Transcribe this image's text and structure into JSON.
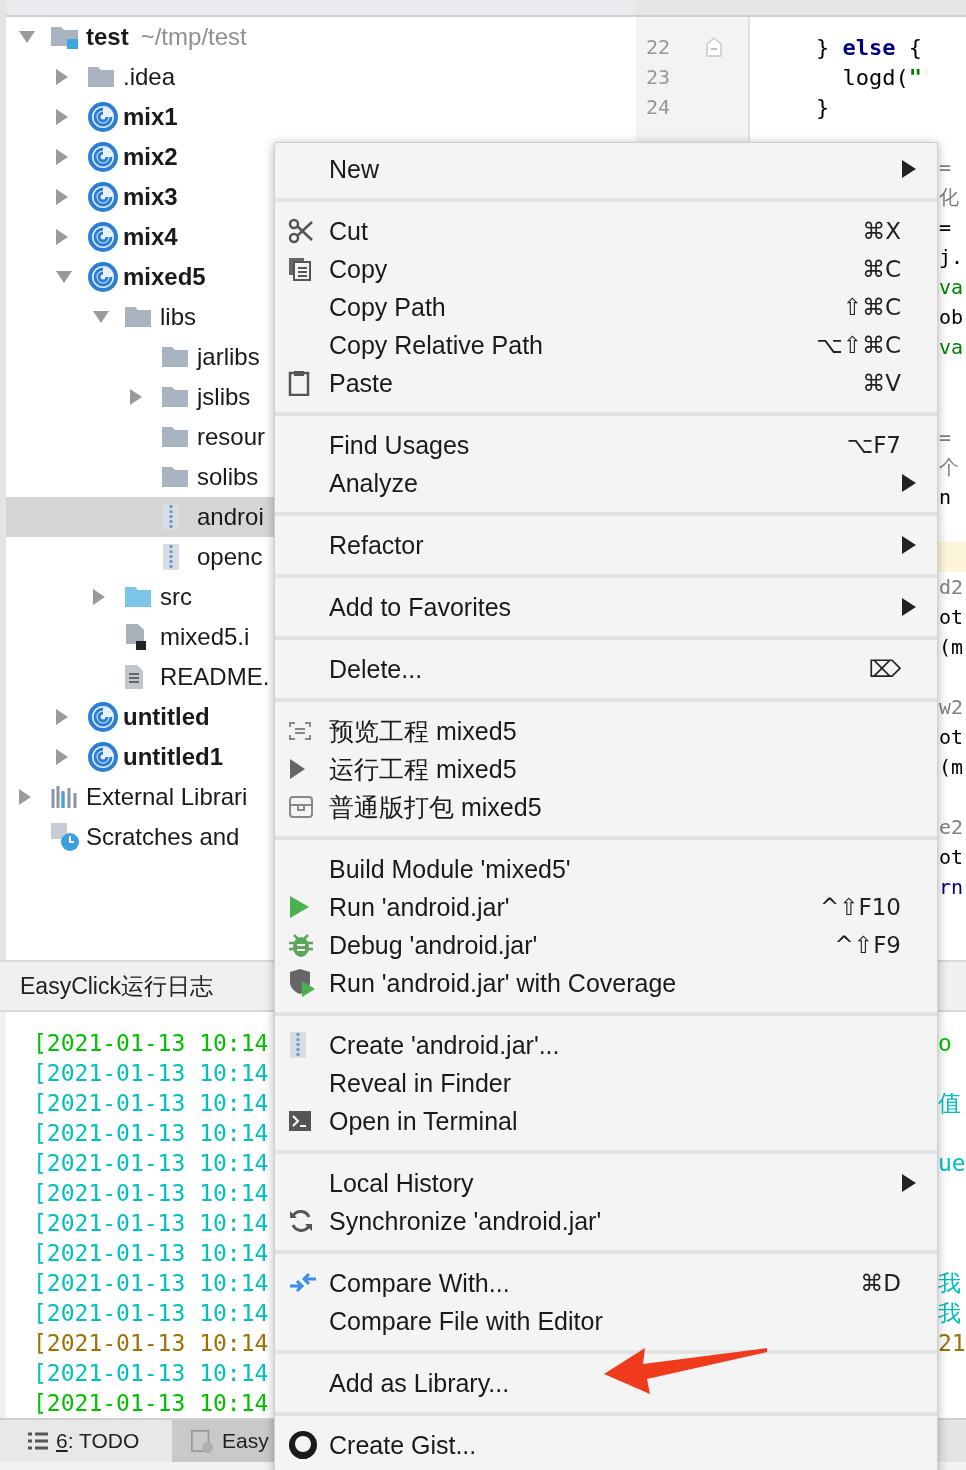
{
  "project_panel": {
    "tree": [
      {
        "label": "test",
        "hint": "~/tmp/test",
        "kind": "project",
        "expanded": true,
        "selected": false,
        "children": [
          {
            "label": ".idea",
            "kind": "folder",
            "expanded": false,
            "selected": false
          },
          {
            "label": "mix1",
            "kind": "module",
            "expanded": false,
            "selected": false
          },
          {
            "label": "mix2",
            "kind": "module",
            "expanded": false,
            "selected": false
          },
          {
            "label": "mix3",
            "kind": "module",
            "expanded": false,
            "selected": false
          },
          {
            "label": "mix4",
            "kind": "module",
            "expanded": false,
            "selected": false
          },
          {
            "label": "mixed5",
            "kind": "module",
            "expanded": true,
            "selected": false,
            "children": [
              {
                "label": "libs",
                "kind": "folder",
                "expanded": true,
                "selected": false,
                "children": [
                  {
                    "label": "jarlibs",
                    "kind": "folder",
                    "selected": false
                  },
                  {
                    "label": "jslibs",
                    "kind": "folder",
                    "expanded": false,
                    "selected": false
                  },
                  {
                    "label": "resour",
                    "kind": "folder",
                    "selected": false
                  },
                  {
                    "label": "solibs",
                    "kind": "folder",
                    "selected": false
                  },
                  {
                    "label": "androi",
                    "kind": "jar",
                    "selected": true
                  },
                  {
                    "label": "openc",
                    "kind": "jar",
                    "selected": false
                  }
                ]
              },
              {
                "label": "src",
                "kind": "source",
                "expanded": false,
                "selected": false
              },
              {
                "label": "mixed5.i",
                "kind": "module-file",
                "selected": false
              },
              {
                "label": "README.",
                "kind": "text-file",
                "selected": false
              }
            ]
          },
          {
            "label": "untitled",
            "kind": "module",
            "expanded": false,
            "selected": false
          },
          {
            "label": "untitled1",
            "kind": "module",
            "expanded": false,
            "selected": false
          }
        ]
      },
      {
        "label": "External Librari",
        "kind": "libraries",
        "expanded": false,
        "selected": false
      },
      {
        "label": "Scratches and",
        "kind": "scratches",
        "selected": false
      }
    ]
  },
  "editor": {
    "lines": [
      {
        "number": "22",
        "fold_marker": true,
        "code": [
          {
            "text": "} ",
            "kind": "plain"
          },
          {
            "text": "else",
            "kind": "keyword"
          },
          {
            "text": " {",
            "kind": "plain"
          }
        ]
      },
      {
        "number": "23",
        "fold_marker": false,
        "code": [
          {
            "text": "  logd(",
            "kind": "plain"
          },
          {
            "text": "\"",
            "kind": "string"
          }
        ]
      },
      {
        "number": "24",
        "fold_marker": false,
        "code": [
          {
            "text": "}",
            "kind": "plain"
          }
        ]
      }
    ],
    "overflow_lines": [
      {
        "kind": "blank"
      },
      {
        "kind": "code",
        "text": "=",
        "color": "#808080"
      },
      {
        "kind": "code",
        "text": "化",
        "color": "#808080"
      },
      {
        "kind": "code",
        "text": "=",
        "color": "#000000"
      },
      {
        "kind": "code",
        "text": "j.",
        "color": "#000000"
      },
      {
        "kind": "code",
        "text": "va",
        "color": "#008000"
      },
      {
        "kind": "code",
        "text": "ob",
        "color": "#000000"
      },
      {
        "kind": "code",
        "text": "va",
        "color": "#008000"
      },
      {
        "kind": "blank"
      },
      {
        "kind": "blank"
      },
      {
        "kind": "code",
        "text": "=",
        "color": "#808080"
      },
      {
        "kind": "code",
        "text": "个",
        "color": "#808080"
      },
      {
        "kind": "code",
        "text": "n",
        "color": "#000000"
      },
      {
        "kind": "blank"
      },
      {
        "kind": "highlight"
      },
      {
        "kind": "code",
        "text": "d2",
        "color": "#808080"
      },
      {
        "kind": "code",
        "text": "ot",
        "color": "#000000"
      },
      {
        "kind": "code",
        "text": "(m",
        "color": "#000000"
      },
      {
        "kind": "blank"
      },
      {
        "kind": "code",
        "text": "w2",
        "color": "#808080"
      },
      {
        "kind": "code",
        "text": "ot",
        "color": "#000000"
      },
      {
        "kind": "code",
        "text": "(m",
        "color": "#000000"
      },
      {
        "kind": "blank"
      },
      {
        "kind": "code",
        "text": "e2",
        "color": "#808080"
      },
      {
        "kind": "code",
        "text": "ot",
        "color": "#000000"
      },
      {
        "kind": "code",
        "text": "rn",
        "color": "#000080"
      }
    ]
  },
  "log_panel": {
    "title": "EasyClick运行日志",
    "rows": [
      {
        "text": "[2021-01-13 10:14",
        "tail": "o",
        "color": "#00c000"
      },
      {
        "text": "[2021-01-13 10:14",
        "color": "#00c0c0"
      },
      {
        "text": "[2021-01-13 10:14",
        "tail": "值",
        "color": "#00c0c0"
      },
      {
        "text": "[2021-01-13 10:14",
        "color": "#00c0c0"
      },
      {
        "text": "[2021-01-13 10:14",
        "tail": "ue",
        "color": "#00c0c0"
      },
      {
        "text": "[2021-01-13 10:14",
        "color": "#00c0c0"
      },
      {
        "text": "[2021-01-13 10:14",
        "color": "#00c0c0"
      },
      {
        "text": "[2021-01-13 10:14",
        "color": "#00c0c0"
      },
      {
        "text": "[2021-01-13 10:14",
        "tail": "我",
        "color": "#00c0c0"
      },
      {
        "text": "[2021-01-13 10:14",
        "tail": "我",
        "color": "#00c0c0"
      },
      {
        "text": "[2021-01-13 10:14",
        "tail": "21",
        "color": "#a07000"
      },
      {
        "text": "[2021-01-13 10:14",
        "color": "#00c0c0"
      },
      {
        "text": "[2021-01-13 10:14",
        "color": "#00c000"
      }
    ]
  },
  "bottom_tabs": [
    {
      "kind": "todo",
      "mnemonic": "6",
      "label": ": TODO",
      "selected": false
    },
    {
      "kind": "log",
      "label": "Easy",
      "selected": true
    }
  ],
  "context_menu": {
    "groups": [
      {
        "items": [
          {
            "label": "New",
            "submenu": true
          }
        ]
      },
      {
        "items": [
          {
            "label": "Cut",
            "kind": "scissors",
            "shortcut": "⌘X"
          },
          {
            "label": "Copy",
            "kind": "copy",
            "shortcut": "⌘C"
          },
          {
            "label": "Copy Path",
            "shortcut": "⇧⌘C"
          },
          {
            "label": "Copy Relative Path",
            "shortcut": "⌥⇧⌘C"
          },
          {
            "label": "Paste",
            "kind": "clipboard",
            "shortcut": "⌘V"
          }
        ]
      },
      {
        "items": [
          {
            "label": "Find Usages",
            "shortcut": "⌥F7"
          },
          {
            "label": "Analyze",
            "submenu": true
          }
        ]
      },
      {
        "items": [
          {
            "label": "Refactor",
            "submenu": true
          }
        ]
      },
      {
        "items": [
          {
            "label": "Add to Favorites",
            "submenu": true
          }
        ]
      },
      {
        "items": [
          {
            "label": "Delete...",
            "shortcut": "⌦"
          }
        ]
      },
      {
        "items": [
          {
            "label": "预览工程 mixed5",
            "kind": "preview"
          },
          {
            "label": "运行工程 mixed5",
            "kind": "play-gray"
          },
          {
            "label": "普通版打包 mixed5",
            "kind": "package"
          }
        ]
      },
      {
        "items": [
          {
            "label": "Build Module 'mixed5'"
          },
          {
            "label": "Run 'android.jar'",
            "kind": "play",
            "shortcut": "^⇧F10"
          },
          {
            "label": "Debug 'android.jar'",
            "kind": "bug",
            "shortcut": "^⇧F9"
          },
          {
            "label": "Run 'android.jar' with Coverage",
            "kind": "shield"
          }
        ]
      },
      {
        "items": [
          {
            "label": "Create 'android.jar'...",
            "kind": "jar"
          },
          {
            "label": "Reveal in Finder"
          },
          {
            "label": "Open in Terminal",
            "kind": "terminal"
          }
        ]
      },
      {
        "items": [
          {
            "label": "Local History",
            "submenu": true
          },
          {
            "label": "Synchronize 'android.jar'",
            "kind": "sync"
          }
        ]
      },
      {
        "items": [
          {
            "label": "Compare With...",
            "kind": "compare",
            "shortcut": "⌘D"
          },
          {
            "label": "Compare File with Editor"
          }
        ]
      },
      {
        "items": [
          {
            "label": "Add as Library..."
          }
        ]
      },
      {
        "items": [
          {
            "label": "Create Gist...",
            "kind": "cat"
          }
        ]
      }
    ]
  }
}
